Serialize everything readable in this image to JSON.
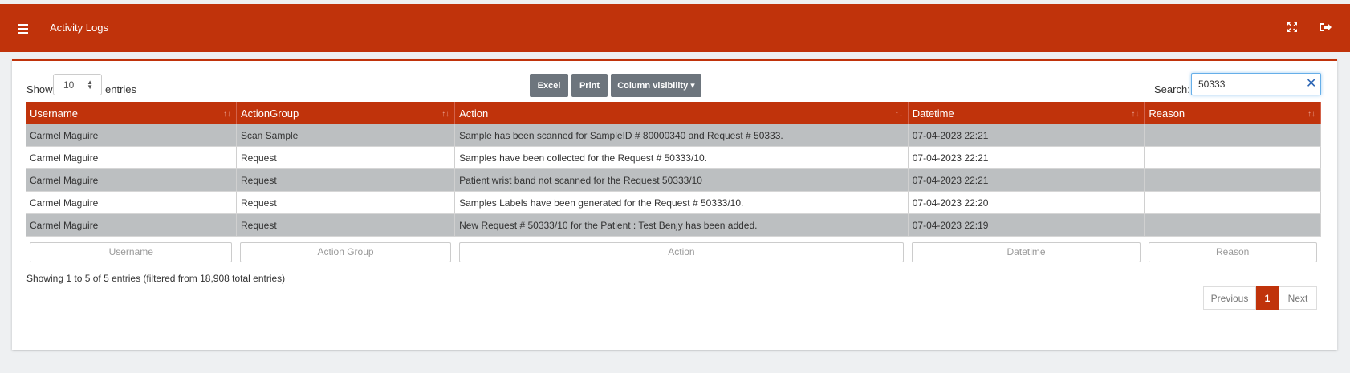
{
  "header": {
    "title": "Activity Logs"
  },
  "length": {
    "show_label": "Show",
    "value": "10",
    "entries_label": "entries"
  },
  "buttons": {
    "excel": "Excel",
    "print": "Print",
    "colvis": "Column visibility ▾"
  },
  "search": {
    "label": "Search:",
    "value": "50333",
    "clear": "✕"
  },
  "columns": [
    "Username",
    "ActionGroup",
    "Action",
    "Datetime",
    "Reason"
  ],
  "sort_glyph": "↑↓",
  "rows": [
    [
      "Carmel Maguire",
      "Scan Sample",
      "Sample has been scanned for SampleID # 80000340 and Request # 50333.",
      "07-04-2023 22:21",
      ""
    ],
    [
      "Carmel Maguire",
      "Request",
      "Samples have been collected for the Request # 50333/10.",
      "07-04-2023 22:21",
      ""
    ],
    [
      "Carmel Maguire",
      "Request",
      "Patient wrist band not scanned for the Request 50333/10",
      "07-04-2023 22:21",
      ""
    ],
    [
      "Carmel Maguire",
      "Request",
      "Samples Labels have been generated for the Request # 50333/10.",
      "07-04-2023 22:20",
      ""
    ],
    [
      "Carmel Maguire",
      "Request",
      "New Request # 50333/10 for the Patient : Test Benjy has been added.",
      "07-04-2023 22:19",
      ""
    ]
  ],
  "filters": [
    "Username",
    "Action Group",
    "Action",
    "Datetime",
    "Reason"
  ],
  "info": "Showing 1 to 5 of 5 entries (filtered from 18,908 total entries)",
  "pagination": {
    "previous": "Previous",
    "current": "1",
    "next": "Next"
  },
  "colors": {
    "brand": "#c0330b",
    "row_alt": "#bcbfc1",
    "button": "#6d757d"
  }
}
